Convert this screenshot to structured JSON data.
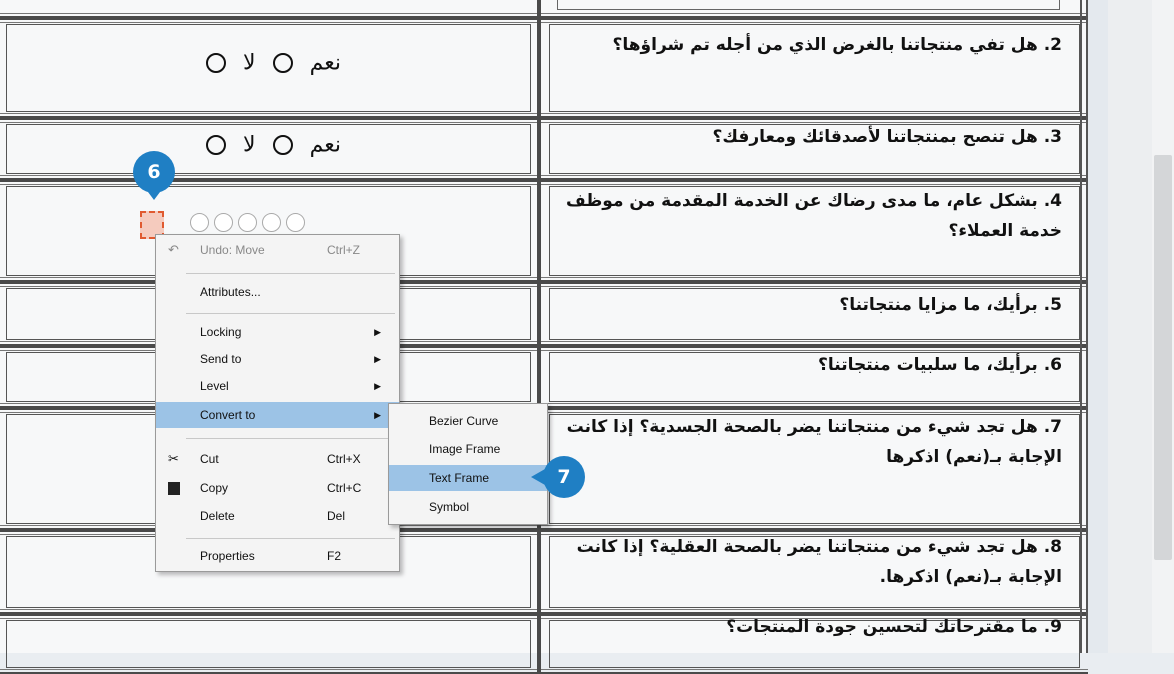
{
  "questions": [
    {
      "text": "2. هل تفي منتجاتنا بالغرض الذي من أجله تم شراؤها؟"
    },
    {
      "text": "3. هل تنصح بمنتجاتنا لأصدقائك ومعارفك؟"
    },
    {
      "text": "4. بشكل عام، ما مدى رضاك عن الخدمة المقدمة من موظف خدمة العملاء؟"
    },
    {
      "text": "5. برأيك، ما مزايا منتجاتنا؟"
    },
    {
      "text": "6. برأيك، ما سلبيات منتجاتنا؟"
    },
    {
      "text": "7. هل تجد شيء من منتجاتنا يضر بالصحة الجسدية؟ إذا كانت الإجابة بـ(نعم) اذكرها"
    },
    {
      "text": "8. هل تجد شيء من منتجاتنا يضر بالصحة العقلية؟ إذا كانت الإجابة بـ(نعم) اذكرها."
    },
    {
      "text": "9. ما مقترحاتك لتحسين جودة المنتجات؟"
    }
  ],
  "options": {
    "yes": "نعم",
    "no": "لا"
  },
  "context_menu": {
    "undo": {
      "label": "Undo: Move",
      "shortcut": "Ctrl+Z"
    },
    "attributes": {
      "label": "Attributes..."
    },
    "locking": {
      "label": "Locking"
    },
    "send_to": {
      "label": "Send to"
    },
    "level": {
      "label": "Level"
    },
    "convert_to": {
      "label": "Convert to"
    },
    "cut": {
      "label": "Cut",
      "shortcut": "Ctrl+X"
    },
    "copy": {
      "label": "Copy",
      "shortcut": "Ctrl+C"
    },
    "delete": {
      "label": "Delete",
      "shortcut": "Del"
    },
    "properties": {
      "label": "Properties",
      "shortcut": "F2"
    }
  },
  "submenu": {
    "bezier": "Bezier Curve",
    "image_frame": "Image Frame",
    "text_frame": "Text Frame",
    "symbol": "Symbol"
  },
  "badges": {
    "step6": "6",
    "step7": "7"
  },
  "icons": {
    "undo": "undo-icon",
    "cut": "scissors-icon",
    "copy": "copy-icon",
    "arrow": "chevron-right-icon"
  },
  "colors": {
    "highlight": "#9cc3e6",
    "badge": "#1f7fc4",
    "selection": "#e05a30"
  }
}
